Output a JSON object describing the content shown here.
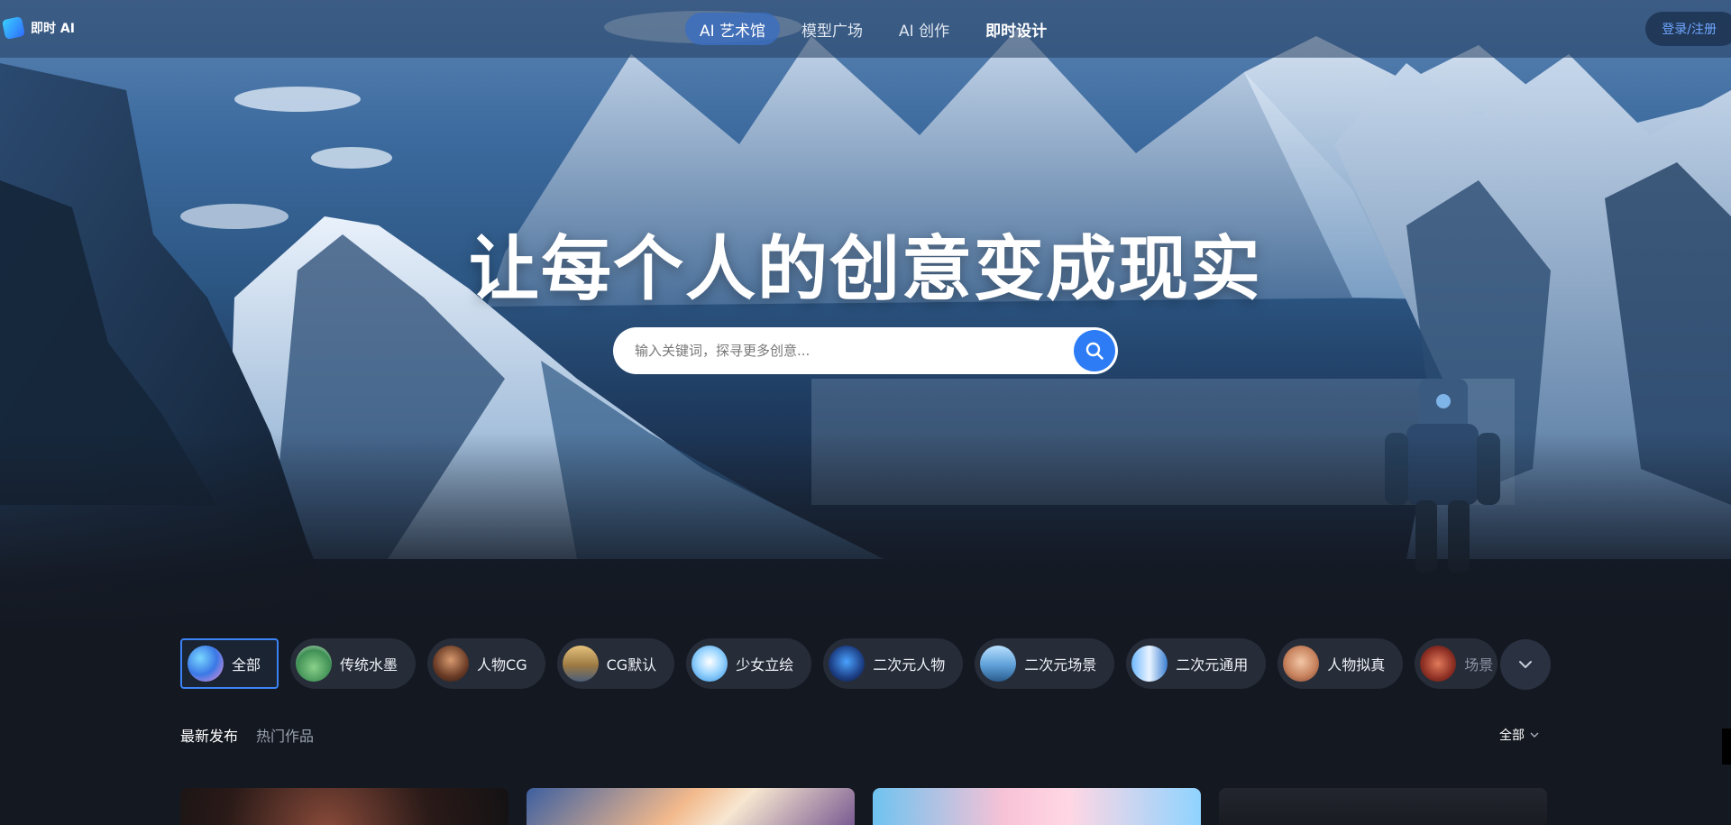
{
  "app": {
    "logo_text": "即时 AI",
    "logo_icon": "jishi-logo-icon"
  },
  "nav": {
    "items": [
      {
        "label": "AI 艺术馆",
        "active": true
      },
      {
        "label": "模型广场",
        "active": false
      },
      {
        "label": "AI 创作",
        "active": false
      },
      {
        "label": "即时设计",
        "active": false
      }
    ],
    "login_label": "登录/注册"
  },
  "hero": {
    "headline": "让每个人的创意变成现实",
    "search_placeholder": "输入关键词，探寻更多创意...",
    "search_icon": "search-icon"
  },
  "categories": {
    "items": [
      {
        "label": "全部",
        "active": true
      },
      {
        "label": "传统水墨",
        "active": false
      },
      {
        "label": "人物CG",
        "active": false
      },
      {
        "label": "CG默认",
        "active": false
      },
      {
        "label": "少女立绘",
        "active": false
      },
      {
        "label": "二次元人物",
        "active": false
      },
      {
        "label": "二次元场景",
        "active": false
      },
      {
        "label": "二次元通用",
        "active": false
      },
      {
        "label": "人物拟真",
        "active": false
      },
      {
        "label": "场景",
        "active": false
      }
    ],
    "more_icon": "chevron-down-icon"
  },
  "feed": {
    "tabs": [
      {
        "label": "最新发布",
        "active": true
      },
      {
        "label": "热门作品",
        "active": false
      }
    ],
    "sort_label": "全部"
  },
  "colors": {
    "accent": "#2d7cf6",
    "nav_active": "#3c6ebe",
    "background": "#141821",
    "chip_bg": "#262c38"
  }
}
